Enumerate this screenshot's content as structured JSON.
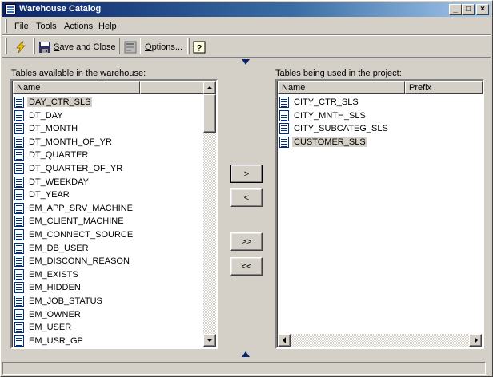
{
  "window": {
    "title": "Warehouse Catalog"
  },
  "title_buttons": {
    "minimize": "_",
    "maximize": "□",
    "close": "×"
  },
  "menu": [
    {
      "label": "File",
      "accel": "F",
      "rest": "ile"
    },
    {
      "label": "Tools",
      "accel": "T",
      "rest": "ools"
    },
    {
      "label": "Actions",
      "accel": "A",
      "rest": "ctions"
    },
    {
      "label": "Help",
      "accel": "H",
      "rest": "elp"
    }
  ],
  "toolbar": {
    "save_close_accel": "S",
    "save_close_rest": "ave and Close",
    "options_accel": "O",
    "options_rest": "ptions..."
  },
  "left_panel": {
    "label_pre": "Tables available in the ",
    "label_accel": "w",
    "label_post": "arehouse:",
    "column_name": "Name",
    "items": [
      "DAY_CTR_SLS",
      "DT_DAY",
      "DT_MONTH",
      "DT_MONTH_OF_YR",
      "DT_QUARTER",
      "DT_QUARTER_OF_YR",
      "DT_WEEKDAY",
      "DT_YEAR",
      "EM_APP_SRV_MACHINE",
      "EM_CLIENT_MACHINE",
      "EM_CONNECT_SOURCE",
      "EM_DB_USER",
      "EM_DISCONN_REASON",
      "EM_EXISTS",
      "EM_HIDDEN",
      "EM_JOB_STATUS",
      "EM_OWNER",
      "EM_USER",
      "EM_USR_GP"
    ],
    "selected_index": 0
  },
  "right_panel": {
    "label": "Tables being used in the project:",
    "column_name": "Name",
    "column_prefix": "Prefix",
    "items": [
      "CITY_CTR_SLS",
      "CITY_MNTH_SLS",
      "CITY_SUBCATEG_SLS",
      "CUSTOMER_SLS"
    ],
    "selected_index": 3
  },
  "transfer_buttons": {
    "add": ">",
    "remove": "<",
    "add_all": ">>",
    "remove_all": "<<"
  }
}
